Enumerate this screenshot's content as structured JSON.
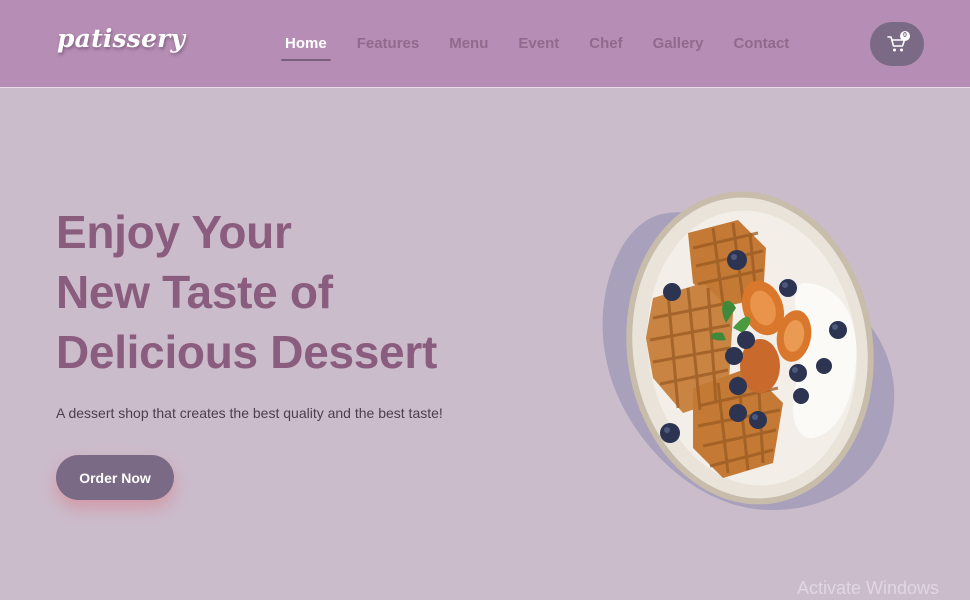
{
  "header": {
    "logo": "patissery",
    "nav": [
      {
        "label": "Home",
        "active": true
      },
      {
        "label": "Features",
        "active": false
      },
      {
        "label": "Menu",
        "active": false
      },
      {
        "label": "Event",
        "active": false
      },
      {
        "label": "Chef",
        "active": false
      },
      {
        "label": "Gallery",
        "active": false
      },
      {
        "label": "Contact",
        "active": false
      }
    ],
    "cart": {
      "icon": "cart-icon",
      "count": "0"
    }
  },
  "hero": {
    "title_lines": [
      "Enjoy Your",
      "New Taste of",
      "Delicious Dessert"
    ],
    "subtitle": "A dessert shop that creates the best quality and the best taste!",
    "cta": "Order Now",
    "image": "waffle-dessert-plate"
  },
  "watermark": "Activate Windows",
  "colors": {
    "header_bg": "#b68eb5",
    "page_bg": "#cbbccc",
    "title": "#8a5c7d",
    "button": "#7b6a85"
  }
}
